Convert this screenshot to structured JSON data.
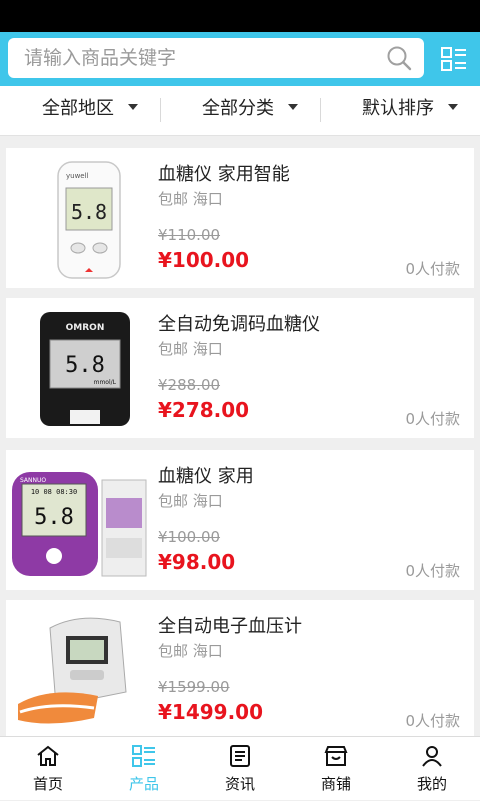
{
  "search": {
    "placeholder": "请输入商品关键字"
  },
  "filters": [
    {
      "label": "全部地区"
    },
    {
      "label": "全部分类"
    },
    {
      "label": "默认排序"
    }
  ],
  "products": [
    {
      "name": "血糖仪 家用智能",
      "location": "包邮 海口",
      "original_price": "¥110.00",
      "price": "¥100.00",
      "sold": "0人付款",
      "brand": "yuwell",
      "reading": "5.8"
    },
    {
      "name": "全自动免调码血糖仪",
      "location": "包邮 海口",
      "original_price": "¥288.00",
      "price": "¥278.00",
      "sold": "0人付款",
      "brand": "OMRON",
      "reading": "5.8",
      "unit": "mmol/L"
    },
    {
      "name": "血糖仪 家用",
      "location": "包邮 海口",
      "original_price": "¥100.00",
      "price": "¥98.00",
      "sold": "0人付款",
      "brand": "SANNUO",
      "reading": "5.8",
      "time": "10 08 08:30"
    },
    {
      "name": "全自动电子血压计",
      "location": "包邮 海口",
      "original_price": "¥1599.00",
      "price": "¥1499.00",
      "sold": "0人付款"
    }
  ],
  "tabs": [
    {
      "label": "首页",
      "icon": "home-icon"
    },
    {
      "label": "产品",
      "icon": "list-icon",
      "active": true
    },
    {
      "label": "资讯",
      "icon": "news-icon"
    },
    {
      "label": "商铺",
      "icon": "store-icon"
    },
    {
      "label": "我的",
      "icon": "user-icon"
    }
  ],
  "colors": {
    "accent": "#3fc6ea",
    "price": "#e8141e",
    "muted": "#9a9a9a"
  }
}
